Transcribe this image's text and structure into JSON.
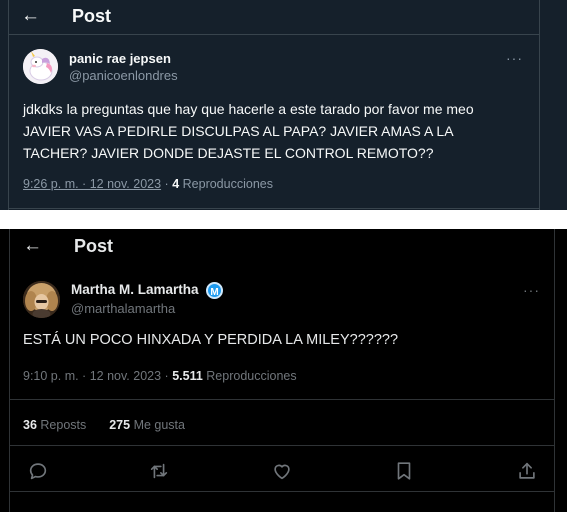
{
  "post1": {
    "header": {
      "title": "Post",
      "back_icon": "arrow-left-icon"
    },
    "author": {
      "name": "panic rae jepsen",
      "handle": "@panicoenlondres"
    },
    "more": "···",
    "text_lines": [
      "jdkdks la preguntas que hay que hacerle a este tarado por favor me meo",
      "JAVIER VAS A PEDIRLE DISCULPAS AL PAPA? JAVIER AMAS A LA",
      "TACHER? JAVIER DONDE DEJASTE EL CONTROL REMOTO??"
    ],
    "meta": {
      "time": "9:26 p. m. · 12 nov. 2023",
      "dot": "·",
      "views": "4",
      "views_label": "Reproducciones"
    },
    "colors": {
      "background": "#15202b",
      "text": "#f7f9f9",
      "muted": "#8b98a5",
      "border": "#38444d"
    }
  },
  "post2": {
    "header": {
      "title": "Post",
      "back_icon": "arrow-left-icon"
    },
    "author": {
      "name": "Martha M. Lamartha",
      "badge": "M",
      "handle": "@marthalamartha"
    },
    "more": "···",
    "text": "ESTÁ UN POCO HINXADA Y PERDIDA LA MILEY??????",
    "meta": {
      "time": "9:10 p. m. · 12 nov. 2023",
      "dot": "·",
      "views": "5.511",
      "views_label": "Reproducciones"
    },
    "stats": {
      "reposts": "36",
      "reposts_label": "Reposts",
      "likes": "275",
      "likes_label": "Me gusta"
    },
    "actions": [
      "reply-icon",
      "repost-icon",
      "like-icon",
      "bookmark-icon",
      "share-icon"
    ],
    "colors": {
      "background": "#000000",
      "text": "#e7e9ea",
      "muted": "#71767b",
      "border": "#2f3336",
      "badge": "#1d9bf0"
    }
  }
}
